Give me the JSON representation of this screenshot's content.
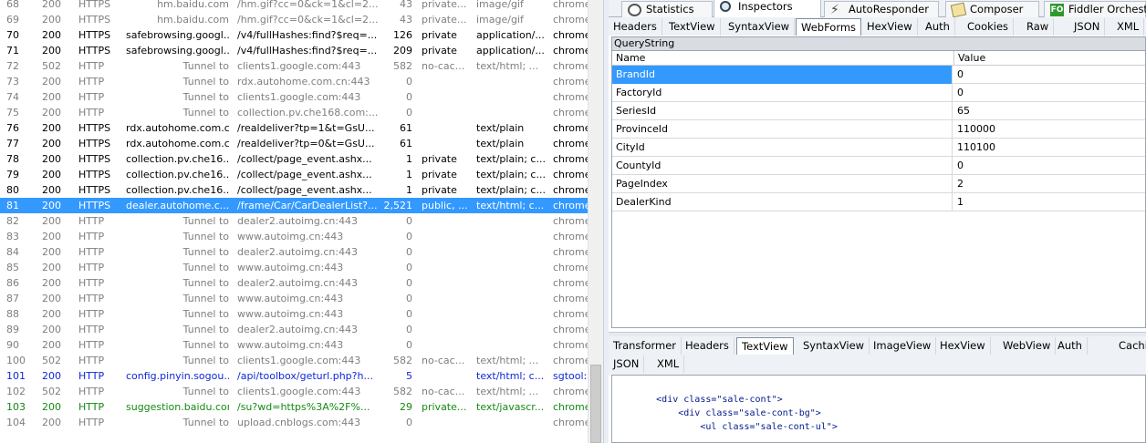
{
  "sessions": [
    {
      "num": "68",
      "result": "200",
      "protocol": "HTTPS",
      "host": "hm.baidu.com",
      "url": "/hm.gif?cc=0&ck=1&cl=2...",
      "body": "43",
      "caching": "private...",
      "content_type": "image/gif",
      "process": "chrome",
      "style": "gray",
      "icon": "gif"
    },
    {
      "num": "69",
      "result": "200",
      "protocol": "HTTPS",
      "host": "hm.baidu.com",
      "url": "/hm.gif?cc=0&ck=1&cl=2...",
      "body": "43",
      "caching": "private...",
      "content_type": "image/gif",
      "process": "chrome",
      "style": "gray",
      "icon": "gif"
    },
    {
      "num": "70",
      "result": "200",
      "protocol": "HTTPS",
      "host": "safebrowsing.googl...",
      "url": "/v4/fullHashes:find?$req=...",
      "body": "126",
      "caching": "private",
      "content_type": "application/...",
      "process": "chrome",
      "style": "black",
      "icon": "doc"
    },
    {
      "num": "71",
      "result": "200",
      "protocol": "HTTPS",
      "host": "safebrowsing.googl...",
      "url": "/v4/fullHashes:find?$req=...",
      "body": "209",
      "caching": "private",
      "content_type": "application/...",
      "process": "chrome",
      "style": "black",
      "icon": "doc"
    },
    {
      "num": "72",
      "result": "502",
      "protocol": "HTTP",
      "host": "Tunnel to",
      "url": "clients1.google.com:443",
      "body": "582",
      "caching": "no-cac...",
      "content_type": "text/html; ...",
      "process": "chrome",
      "style": "gray",
      "icon": "err"
    },
    {
      "num": "73",
      "result": "200",
      "protocol": "HTTP",
      "host": "Tunnel to",
      "url": "rdx.autohome.com.cn:443",
      "body": "0",
      "caching": "",
      "content_type": "",
      "process": "chrome",
      "style": "gray",
      "icon": "lock"
    },
    {
      "num": "74",
      "result": "200",
      "protocol": "HTTP",
      "host": "Tunnel to",
      "url": "clients1.google.com:443",
      "body": "0",
      "caching": "",
      "content_type": "",
      "process": "chrome",
      "style": "gray",
      "icon": "lock"
    },
    {
      "num": "75",
      "result": "200",
      "protocol": "HTTP",
      "host": "Tunnel to",
      "url": "collection.pv.che168.com:...",
      "body": "0",
      "caching": "",
      "content_type": "",
      "process": "chrome",
      "style": "gray",
      "icon": "lock"
    },
    {
      "num": "76",
      "result": "200",
      "protocol": "HTTPS",
      "host": "rdx.autohome.com.cn",
      "url": "/realdeliver?tp=1&t=GsU...",
      "body": "61",
      "caching": "",
      "content_type": "text/plain",
      "process": "chrome",
      "style": "black",
      "icon": "doc"
    },
    {
      "num": "77",
      "result": "200",
      "protocol": "HTTPS",
      "host": "rdx.autohome.com.cn",
      "url": "/realdeliver?tp=0&t=GsU...",
      "body": "61",
      "caching": "",
      "content_type": "text/plain",
      "process": "chrome",
      "style": "black",
      "icon": "doc"
    },
    {
      "num": "78",
      "result": "200",
      "protocol": "HTTPS",
      "host": "collection.pv.che16...",
      "url": "/collect/page_event.ashx...",
      "body": "1",
      "caching": "private",
      "content_type": "text/plain; c...",
      "process": "chrome",
      "style": "black",
      "icon": "doc"
    },
    {
      "num": "79",
      "result": "200",
      "protocol": "HTTPS",
      "host": "collection.pv.che16...",
      "url": "/collect/page_event.ashx...",
      "body": "1",
      "caching": "private",
      "content_type": "text/plain; c...",
      "process": "chrome",
      "style": "black",
      "icon": "doc"
    },
    {
      "num": "80",
      "result": "200",
      "protocol": "HTTPS",
      "host": "collection.pv.che16...",
      "url": "/collect/page_event.ashx...",
      "body": "1",
      "caching": "private",
      "content_type": "text/plain; c...",
      "process": "chrome",
      "style": "black",
      "icon": "doc"
    },
    {
      "num": "81",
      "result": "200",
      "protocol": "HTTPS",
      "host": "dealer.autohome.c...",
      "url": "/frame/Car/CarDealerList?...",
      "body": "2,521",
      "caching": "public, ...",
      "content_type": "text/html; c...",
      "process": "chrome",
      "style": "selected",
      "icon": "tri"
    },
    {
      "num": "82",
      "result": "200",
      "protocol": "HTTP",
      "host": "Tunnel to",
      "url": "dealer2.autoimg.cn:443",
      "body": "0",
      "caching": "",
      "content_type": "",
      "process": "chrome",
      "style": "gray",
      "icon": "lock"
    },
    {
      "num": "83",
      "result": "200",
      "protocol": "HTTP",
      "host": "Tunnel to",
      "url": "www.autoimg.cn:443",
      "body": "0",
      "caching": "",
      "content_type": "",
      "process": "chrome",
      "style": "gray",
      "icon": "lock"
    },
    {
      "num": "84",
      "result": "200",
      "protocol": "HTTP",
      "host": "Tunnel to",
      "url": "dealer2.autoimg.cn:443",
      "body": "0",
      "caching": "",
      "content_type": "",
      "process": "chrome",
      "style": "gray",
      "icon": "lock"
    },
    {
      "num": "85",
      "result": "200",
      "protocol": "HTTP",
      "host": "Tunnel to",
      "url": "www.autoimg.cn:443",
      "body": "0",
      "caching": "",
      "content_type": "",
      "process": "chrome",
      "style": "gray",
      "icon": "lock"
    },
    {
      "num": "86",
      "result": "200",
      "protocol": "HTTP",
      "host": "Tunnel to",
      "url": "dealer2.autoimg.cn:443",
      "body": "0",
      "caching": "",
      "content_type": "",
      "process": "chrome",
      "style": "gray",
      "icon": "lock"
    },
    {
      "num": "87",
      "result": "200",
      "protocol": "HTTP",
      "host": "Tunnel to",
      "url": "www.autoimg.cn:443",
      "body": "0",
      "caching": "",
      "content_type": "",
      "process": "chrome",
      "style": "gray",
      "icon": "lock"
    },
    {
      "num": "88",
      "result": "200",
      "protocol": "HTTP",
      "host": "Tunnel to",
      "url": "www.autoimg.cn:443",
      "body": "0",
      "caching": "",
      "content_type": "",
      "process": "chrome",
      "style": "gray",
      "icon": "lock"
    },
    {
      "num": "89",
      "result": "200",
      "protocol": "HTTP",
      "host": "Tunnel to",
      "url": "dealer2.autoimg.cn:443",
      "body": "0",
      "caching": "",
      "content_type": "",
      "process": "chrome",
      "style": "gray",
      "icon": "lock"
    },
    {
      "num": "90",
      "result": "200",
      "protocol": "HTTP",
      "host": "Tunnel to",
      "url": "www.autoimg.cn:443",
      "body": "0",
      "caching": "",
      "content_type": "",
      "process": "chrome",
      "style": "gray",
      "icon": "lock"
    },
    {
      "num": "100",
      "result": "502",
      "protocol": "HTTP",
      "host": "Tunnel to",
      "url": "clients1.google.com:443",
      "body": "582",
      "caching": "no-cac...",
      "content_type": "text/html; ...",
      "process": "chrome",
      "style": "gray",
      "icon": "err"
    },
    {
      "num": "101",
      "result": "200",
      "protocol": "HTTP",
      "host": "config.pinyin.sogou...",
      "url": "/api/toolbox/geturl.php?h...",
      "body": "5",
      "caching": "",
      "content_type": "text/html; c...",
      "process": "sgtool:",
      "style": "blue",
      "icon": "tri"
    },
    {
      "num": "102",
      "result": "502",
      "protocol": "HTTP",
      "host": "Tunnel to",
      "url": "clients1.google.com:443",
      "body": "582",
      "caching": "no-cac...",
      "content_type": "text/html; ...",
      "process": "chrome",
      "style": "gray",
      "icon": "err"
    },
    {
      "num": "103",
      "result": "200",
      "protocol": "HTTP",
      "host": "suggestion.baidu.com",
      "url": "/su?wd=https%3A%2F%...",
      "body": "29",
      "caching": "private...",
      "content_type": "text/javascr...",
      "process": "chrome",
      "style": "green",
      "icon": "js"
    },
    {
      "num": "104",
      "result": "200",
      "protocol": "HTTP",
      "host": "Tunnel to",
      "url": "upload.cnblogs.com:443",
      "body": "0",
      "caching": "",
      "content_type": "",
      "process": "chrome",
      "style": "gray",
      "icon": "lock"
    }
  ],
  "top_tabs": [
    {
      "label": "Statistics",
      "icon": "statistics-icon",
      "active": false
    },
    {
      "label": "Inspectors",
      "icon": "inspectors-icon",
      "active": true
    },
    {
      "label": "AutoResponder",
      "icon": "autoresponder-icon",
      "active": false
    },
    {
      "label": "Composer",
      "icon": "composer-icon",
      "active": false
    },
    {
      "label": "Fiddler Orchestra",
      "icon": "fiddler-orchestra-icon",
      "active": false
    }
  ],
  "request_tabs": [
    {
      "label": "Headers",
      "active": false
    },
    {
      "label": "TextView",
      "active": false
    },
    {
      "label": "SyntaxView",
      "active": false
    },
    {
      "label": "WebForms",
      "active": true
    },
    {
      "label": "HexView",
      "active": false
    },
    {
      "label": "Auth",
      "active": false
    },
    {
      "label": "Cookies",
      "active": false
    },
    {
      "label": "Raw",
      "active": false
    },
    {
      "label": "JSON",
      "active": false
    },
    {
      "label": "XML",
      "active": false
    }
  ],
  "querystring": {
    "section_title": "QueryString",
    "col_name": "Name",
    "col_value": "Value",
    "rows": [
      {
        "name": "BrandId",
        "value": "0"
      },
      {
        "name": "FactoryId",
        "value": "0"
      },
      {
        "name": "SeriesId",
        "value": "65"
      },
      {
        "name": "ProvinceId",
        "value": "110000"
      },
      {
        "name": "CityId",
        "value": "110100"
      },
      {
        "name": "CountyId",
        "value": "0"
      },
      {
        "name": "PageIndex",
        "value": "2"
      },
      {
        "name": "DealerKind",
        "value": "1"
      }
    ]
  },
  "response_tabs_row1": [
    {
      "label": "Transformer",
      "active": false
    },
    {
      "label": "Headers",
      "active": false
    },
    {
      "label": "TextView",
      "active": true
    },
    {
      "label": "SyntaxView",
      "active": false
    },
    {
      "label": "ImageView",
      "active": false
    },
    {
      "label": "HexView",
      "active": false
    },
    {
      "label": "WebView",
      "active": false
    },
    {
      "label": "Auth",
      "active": false
    },
    {
      "label": "Caching",
      "active": false
    }
  ],
  "response_tabs_row2": [
    {
      "label": "JSON",
      "active": false
    },
    {
      "label": "XML",
      "active": false
    }
  ],
  "response_text": [
    "        <div class=\"sale-cont\">",
    "            <div class=\"sale-cont-bg\">",
    "                <ul class=\"sale-cont-ul\">"
  ],
  "colors": {
    "selected": "#3399ff",
    "gray_text": "#7f7f7f",
    "blue_text": "#1028d6",
    "green_text": "#148a14"
  }
}
